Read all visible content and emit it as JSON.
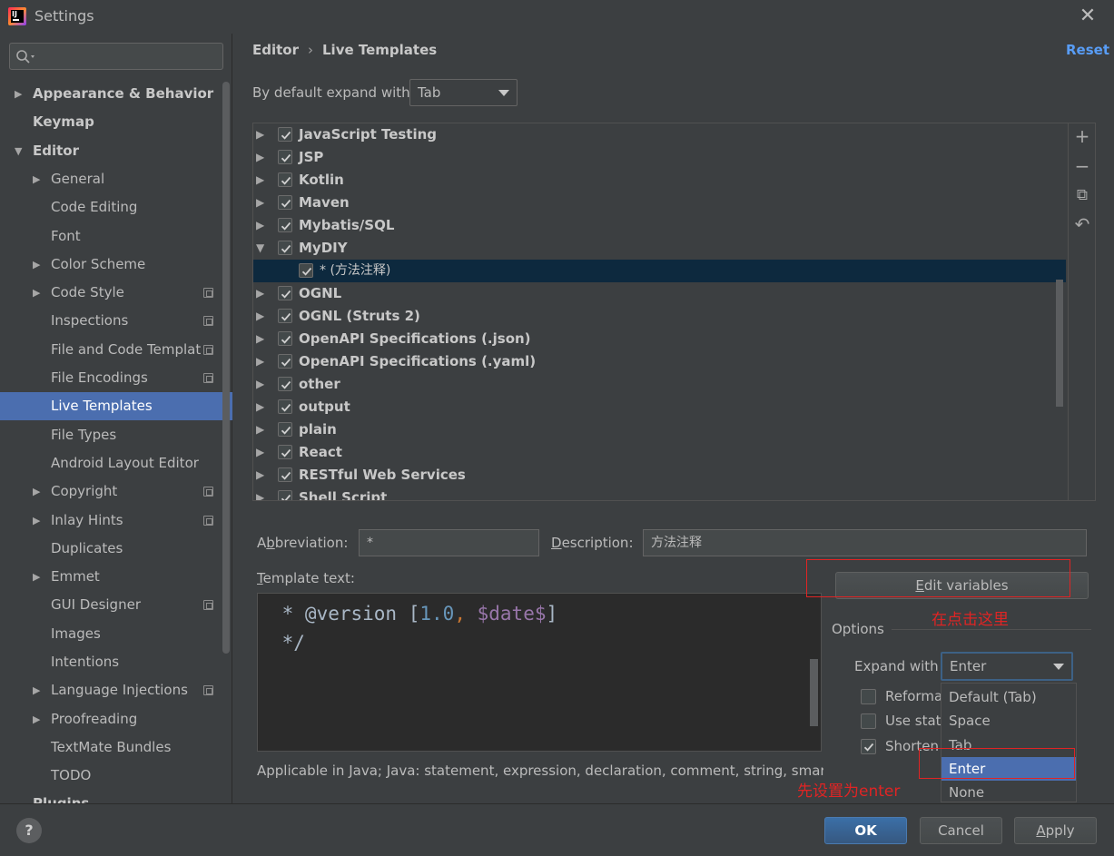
{
  "window": {
    "title": "Settings"
  },
  "search": {
    "placeholder": ""
  },
  "sidebar": {
    "items": [
      {
        "label": "Appearance & Behavior",
        "arrow": "▶",
        "bold": true,
        "indent": 0
      },
      {
        "label": "Keymap",
        "arrow": "",
        "bold": true,
        "indent": 0
      },
      {
        "label": "Editor",
        "arrow": "▼",
        "bold": true,
        "indent": 0
      },
      {
        "label": "General",
        "arrow": "▶",
        "bold": false,
        "indent": 1
      },
      {
        "label": "Code Editing",
        "arrow": "",
        "bold": false,
        "indent": 1
      },
      {
        "label": "Font",
        "arrow": "",
        "bold": false,
        "indent": 1
      },
      {
        "label": "Color Scheme",
        "arrow": "▶",
        "bold": false,
        "indent": 1
      },
      {
        "label": "Code Style",
        "arrow": "▶",
        "bold": false,
        "indent": 1,
        "icon": true
      },
      {
        "label": "Inspections",
        "arrow": "",
        "bold": false,
        "indent": 1,
        "icon": true
      },
      {
        "label": "File and Code Templat",
        "arrow": "",
        "bold": false,
        "indent": 1,
        "icon": true
      },
      {
        "label": "File Encodings",
        "arrow": "",
        "bold": false,
        "indent": 1,
        "icon": true
      },
      {
        "label": "Live Templates",
        "arrow": "",
        "bold": false,
        "indent": 1,
        "selected": true
      },
      {
        "label": "File Types",
        "arrow": "",
        "bold": false,
        "indent": 1
      },
      {
        "label": "Android Layout Editor",
        "arrow": "",
        "bold": false,
        "indent": 1
      },
      {
        "label": "Copyright",
        "arrow": "▶",
        "bold": false,
        "indent": 1,
        "icon": true
      },
      {
        "label": "Inlay Hints",
        "arrow": "▶",
        "bold": false,
        "indent": 1,
        "icon": true
      },
      {
        "label": "Duplicates",
        "arrow": "",
        "bold": false,
        "indent": 1
      },
      {
        "label": "Emmet",
        "arrow": "▶",
        "bold": false,
        "indent": 1
      },
      {
        "label": "GUI Designer",
        "arrow": "",
        "bold": false,
        "indent": 1,
        "icon": true
      },
      {
        "label": "Images",
        "arrow": "",
        "bold": false,
        "indent": 1
      },
      {
        "label": "Intentions",
        "arrow": "",
        "bold": false,
        "indent": 1
      },
      {
        "label": "Language Injections",
        "arrow": "▶",
        "bold": false,
        "indent": 1,
        "icon": true
      },
      {
        "label": "Proofreading",
        "arrow": "▶",
        "bold": false,
        "indent": 1
      },
      {
        "label": "TextMate Bundles",
        "arrow": "",
        "bold": false,
        "indent": 1
      },
      {
        "label": "TODO",
        "arrow": "",
        "bold": false,
        "indent": 1
      }
    ],
    "partial_item": "Plugins"
  },
  "breadcrumb": {
    "parent": "Editor",
    "sep": "›",
    "current": "Live Templates"
  },
  "reset_label": "Reset",
  "expand_default": {
    "label": "By default expand with",
    "value": "Tab"
  },
  "template_groups": [
    {
      "label": "JavaScript Testing",
      "arrow": "▶",
      "checked": true
    },
    {
      "label": "JSP",
      "arrow": "▶",
      "checked": true
    },
    {
      "label": "Kotlin",
      "arrow": "▶",
      "checked": true
    },
    {
      "label": "Maven",
      "arrow": "▶",
      "checked": true
    },
    {
      "label": "Mybatis/SQL",
      "arrow": "▶",
      "checked": true
    },
    {
      "label": "MyDIY",
      "arrow": "▼",
      "checked": true
    },
    {
      "label": "* (方法注释)",
      "arrow": "",
      "checked": true,
      "child": true,
      "selected": true
    },
    {
      "label": "OGNL",
      "arrow": "▶",
      "checked": true
    },
    {
      "label": "OGNL (Struts 2)",
      "arrow": "▶",
      "checked": true
    },
    {
      "label": "OpenAPI Specifications (.json)",
      "arrow": "▶",
      "checked": true
    },
    {
      "label": "OpenAPI Specifications (.yaml)",
      "arrow": "▶",
      "checked": true
    },
    {
      "label": "other",
      "arrow": "▶",
      "checked": true
    },
    {
      "label": "output",
      "arrow": "▶",
      "checked": true
    },
    {
      "label": "plain",
      "arrow": "▶",
      "checked": true
    },
    {
      "label": "React",
      "arrow": "▶",
      "checked": true
    },
    {
      "label": "RESTful Web Services",
      "arrow": "▶",
      "checked": true
    },
    {
      "label": "Shell Script",
      "arrow": "▶",
      "checked": true
    }
  ],
  "toolbar": {
    "add": "+",
    "remove": "−",
    "copy": "⧉",
    "restore": "↶"
  },
  "abbreviation": {
    "label_pre": "A",
    "label_u": "b",
    "label_post": "breviation:",
    "value": "*"
  },
  "description": {
    "label_u": "D",
    "label_post": "escription:",
    "value": "方法注释"
  },
  "template_text": {
    "label_u": "T",
    "label_post": "emplate text:",
    "line1": {
      "a": " * @version [",
      "num": "1.0",
      "comma": ",",
      "space": " ",
      "var": "$date$",
      "end": "]"
    },
    "line2": " */"
  },
  "applicable_text": "Applicable in Java; Java: statement, expression, declaration, comment, string, smart type completion...",
  "edit_variables": {
    "label_u": "E",
    "label_post": "dit variables"
  },
  "options": {
    "title": "Options",
    "expand_with_label": "Expand with",
    "expand_with_value": "Enter",
    "checkboxes": [
      {
        "label": "Reformat according to style",
        "checked": false
      },
      {
        "label": "Use static import if possible",
        "checked": false
      },
      {
        "label": "Shorten FQ names",
        "checked": true
      }
    ]
  },
  "dropdown": {
    "items": [
      "Default (Tab)",
      "Space",
      "Tab",
      "Enter",
      "None"
    ],
    "selected": "Enter"
  },
  "annotations": {
    "click_here": "在点击这里",
    "set_enter": "先设置为enter",
    "color": "#e02424"
  },
  "buttons": {
    "help": "?",
    "ok": "OK",
    "cancel": "Cancel",
    "apply_u": "A",
    "apply_post": "pply"
  },
  "colors": {
    "accent": "#4b6eaf",
    "link": "#589df6",
    "selected_row": "#0d293e",
    "background": "#3c3f41"
  }
}
